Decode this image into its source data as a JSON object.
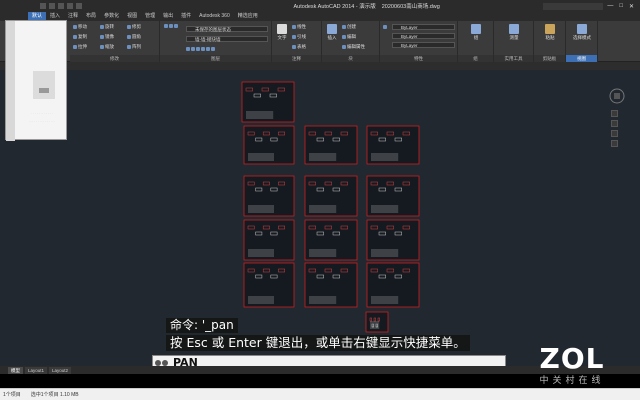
{
  "titlebar": {
    "app": "Autodesk AutoCAD 2014 - 演示版",
    "file": "20200603南山商场.dwg",
    "window_controls": [
      "—",
      "□",
      "✕"
    ]
  },
  "ribbon_tabs": [
    {
      "label": "默认",
      "active": true
    },
    {
      "label": "插入"
    },
    {
      "label": "注释"
    },
    {
      "label": "布局"
    },
    {
      "label": "参数化"
    },
    {
      "label": "视图"
    },
    {
      "label": "管理"
    },
    {
      "label": "输出"
    },
    {
      "label": "插件"
    },
    {
      "label": "Autodesk 360"
    },
    {
      "label": "精选应用"
    }
  ],
  "ribbon": {
    "modify": {
      "title": "修改",
      "items": [
        "移动",
        "旋转",
        "修剪",
        "复制",
        "镜像",
        "圆角",
        "拉伸",
        "缩放",
        "阵列"
      ]
    },
    "layers": {
      "title": "图层",
      "state": "未保存的图层状态",
      "current": "墙-墙-砌块墙"
    },
    "annotation": {
      "title": "注释",
      "text_label": "文字",
      "items": [
        "线性",
        "引线",
        "表格"
      ]
    },
    "block": {
      "title": "块",
      "insert_label": "插入",
      "items": [
        "创建",
        "编辑",
        "编辑属性"
      ]
    },
    "properties": {
      "title": "特性",
      "bylayer": [
        "ByLayer",
        "ByLayer",
        "ByLayer"
      ]
    },
    "groups": {
      "title": "组",
      "label": "组"
    },
    "utilities": {
      "title": "实用工具",
      "label": "测量"
    },
    "clipboard": {
      "title": "剪贴板",
      "label": "粘贴"
    },
    "view": {
      "title": "视图",
      "label": "选择模式"
    }
  },
  "subtitles": {
    "line1": "命令: '_pan",
    "line2": "按 Esc 或 Enter 键退出，或单击右键显示快捷菜单。"
  },
  "command": {
    "text": "PAN"
  },
  "layout_tabs": [
    "模型",
    "Layout1",
    "Layout2"
  ],
  "statusbar": {
    "items": [
      "1个项目",
      "选中1个项目 1.10 MB"
    ]
  },
  "watermark": {
    "logo": "ZOL",
    "tagline": "中关村在线"
  },
  "colors": {
    "canvas": "#212830",
    "ribbon": "#3b3b3b",
    "accent": "#3c6fb4",
    "sheet_border": "#cc2020"
  }
}
